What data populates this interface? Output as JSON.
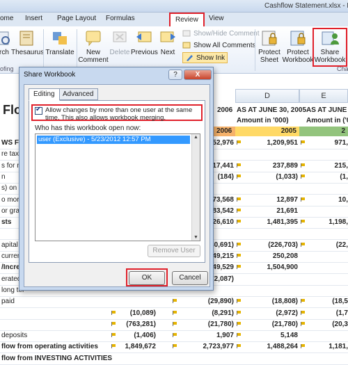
{
  "window": {
    "title": "Cashflow Statement.xlsx - M"
  },
  "tabs": [
    "ome",
    "Insert",
    "Page Layout",
    "Formulas",
    "Review",
    "View"
  ],
  "ribbon": {
    "research_label": "rch",
    "thesaurus_label": "Thesaurus",
    "translate_label": "Translate",
    "new_comment_label": "New Comment",
    "delete_label": "Delete",
    "previous_label": "Previous",
    "next_label": "Next",
    "show_hide_comment": "Show/Hide Comment",
    "show_all_comments": "Show All Comments",
    "show_ink": "Show Ink",
    "protect_sheet": "Protect Sheet",
    "protect_workbook": "Protect Workbook",
    "share_workbook": "Share Workbook",
    "group_proofing": "ofing",
    "group_changes": "Cha"
  },
  "sheet": {
    "title_fragment": "Flo",
    "col_d": "D",
    "col_e": "E",
    "hdr_2006": "2006",
    "hdr_as_at_2005": "AS AT JUNE 30, 2005",
    "hdr_as_at_e": "AS AT JUNE 30, 2",
    "amount_label": "Amount in '000)",
    "amount_label_e": "Amount in ('00",
    "band_2006": "2006",
    "band_2005": "2005",
    "band_e": "2",
    "left_labels": [
      "WS FRO",
      "re taxati",
      "s for no",
      "n",
      "s) on sa",
      "o more p",
      "or gratui",
      "sts",
      "",
      "apital c",
      "current",
      "/Increas",
      "erated",
      "long ter",
      "paid",
      "",
      "",
      "deposits",
      "flow from operating activities",
      "flow from INVESTING ACTIVITIES"
    ],
    "col_c_values": [
      "52,976",
      "",
      "17,441",
      "(184)",
      "",
      "73,568",
      "83,542",
      "26,610",
      "",
      "30,691)",
      "49,215",
      "49,529",
      "72,087)",
      "",
      "(29,890)",
      "(8,291)",
      "(21,780)",
      "1,907",
      "2,723,977",
      ""
    ],
    "col_d_values": [
      "1,209,951",
      "",
      "237,889",
      "(1,033)",
      "",
      "12,897",
      "21,691",
      "1,481,395",
      "",
      "(226,703)",
      "250,208",
      "1,504,900",
      "",
      "",
      "(18,808)",
      "(2,972)",
      "(21,780)",
      "5,148",
      "1,488,264",
      ""
    ],
    "col_e_values": [
      "971,",
      "",
      "215,",
      "(1,",
      "",
      "10,",
      "",
      "1,198,",
      "",
      "(22,",
      "",
      "",
      "",
      "",
      "(18,5",
      "(1,7",
      "(20,3",
      "",
      "1,181,",
      ""
    ],
    "row_b_values": [
      "",
      "",
      "",
      "",
      "",
      "",
      "",
      "",
      "",
      "",
      "",
      "",
      "",
      "",
      "",
      "(10,089)",
      "(763,281)",
      "(1,406)",
      "1,849,672",
      ""
    ]
  },
  "dialog": {
    "title": "Share Workbook",
    "help": "?",
    "close": "X",
    "tab_editing": "Editing",
    "tab_advanced": "Advanced",
    "allow_changes_text": "Allow changes by more than one user at the same time.  This also allows workbook merging.",
    "who_has_label": "Who has this workbook open now:",
    "users": [
      "user (Exclusive) - 5/23/2012 12:57 PM"
    ],
    "remove_user": "Remove User",
    "ok": "OK",
    "cancel": "Cancel"
  }
}
